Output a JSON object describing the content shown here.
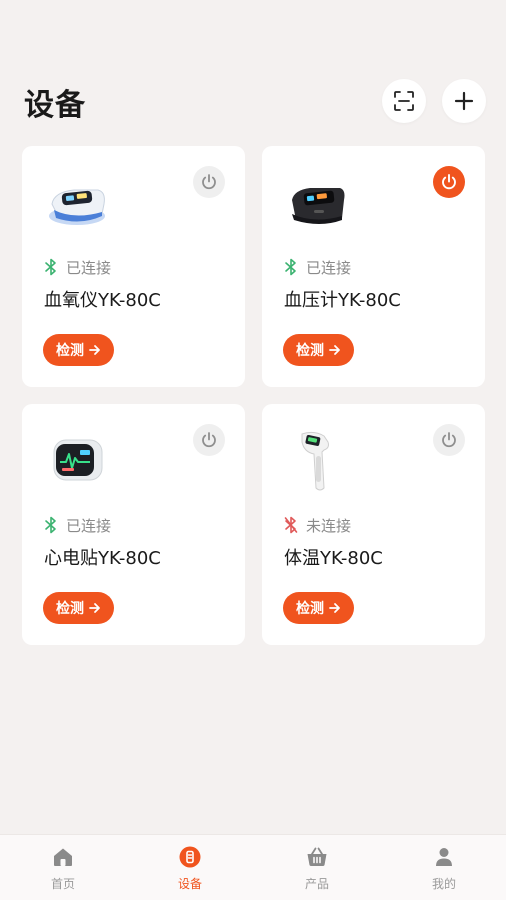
{
  "header": {
    "title": "设备",
    "scan_icon": "scan-icon",
    "add_icon": "plus-icon"
  },
  "devices": [
    {
      "name": "血氧仪YK-80C",
      "status": "已连接",
      "connected": true,
      "power": "off",
      "image": "pulse-oximeter",
      "action_label": "检测"
    },
    {
      "name": "血压计YK-80C",
      "status": "已连接",
      "connected": true,
      "power": "on",
      "image": "blood-pressure-monitor",
      "action_label": "检测"
    },
    {
      "name": "心电贴YK-80C",
      "status": "已连接",
      "connected": true,
      "power": "off",
      "image": "ecg-patch",
      "action_label": "检测"
    },
    {
      "name": "体温YK-80C",
      "status": "未连接",
      "connected": false,
      "power": "off",
      "image": "thermometer",
      "action_label": "检测"
    }
  ],
  "tabbar": {
    "items": [
      {
        "label": "首页",
        "icon": "home-icon",
        "active": false
      },
      {
        "label": "设备",
        "icon": "device-icon",
        "active": true
      },
      {
        "label": "产品",
        "icon": "basket-icon",
        "active": false
      },
      {
        "label": "我的",
        "icon": "user-icon",
        "active": false
      }
    ]
  },
  "colors": {
    "accent": "#f0541e",
    "connected": "#3cb371",
    "disconnected": "#e05a5a",
    "background": "#f4f1f0"
  }
}
